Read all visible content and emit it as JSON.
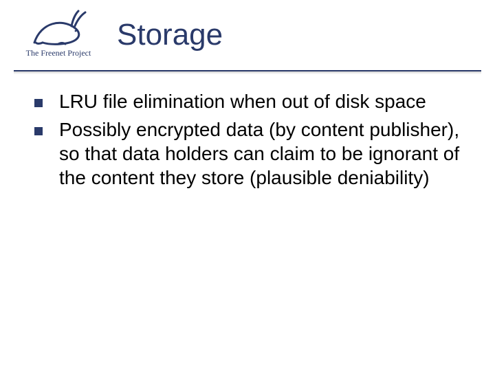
{
  "header": {
    "logo_caption": "The Freenet Project",
    "title": "Storage"
  },
  "bullets": [
    "LRU file elimination when out of disk space",
    "Possibly encrypted data (by content publisher), so that data holders can claim to be ignorant of the content they store (plausible deniability)"
  ]
}
